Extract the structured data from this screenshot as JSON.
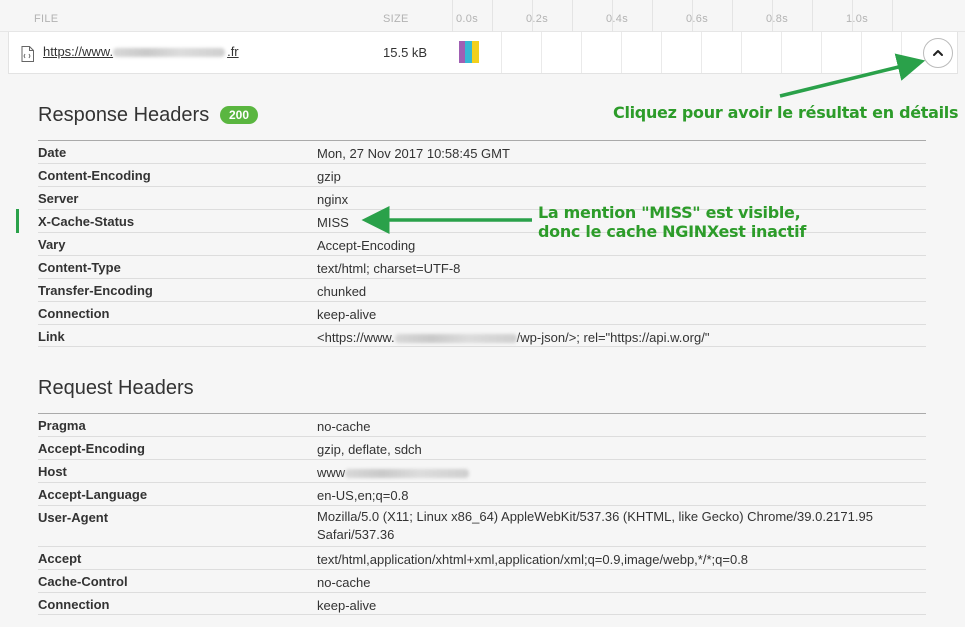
{
  "columns": {
    "file": "FILE",
    "size": "SIZE"
  },
  "timeline_ticks": [
    "0.0s",
    "0.2s",
    "0.4s",
    "0.6s",
    "0.8s",
    "1.0s"
  ],
  "file": {
    "url_prefix": "https://www.",
    "url_suffix": ".fr",
    "size": "15.5 kB",
    "bar_colors": [
      "#a05fb3",
      "#36b8d4",
      "#f2d01c"
    ]
  },
  "response": {
    "title": "Response Headers",
    "status": "200",
    "headers": [
      {
        "key": "Date",
        "value": "Mon, 27 Nov 2017 10:58:45 GMT"
      },
      {
        "key": "Content-Encoding",
        "value": "gzip"
      },
      {
        "key": "Server",
        "value": "nginx"
      },
      {
        "key": "X-Cache-Status",
        "value": "MISS"
      },
      {
        "key": "Vary",
        "value": "Accept-Encoding"
      },
      {
        "key": "Content-Type",
        "value": "text/html; charset=UTF-8"
      },
      {
        "key": "Transfer-Encoding",
        "value": "chunked"
      },
      {
        "key": "Connection",
        "value": "keep-alive"
      },
      {
        "key": "Link",
        "value_prefix": "<https://www.",
        "value_suffix": "/wp-json/>; rel=\"https://api.w.org/\""
      }
    ]
  },
  "request": {
    "title": "Request Headers",
    "headers": [
      {
        "key": "Pragma",
        "value": "no-cache"
      },
      {
        "key": "Accept-Encoding",
        "value": "gzip, deflate, sdch"
      },
      {
        "key": "Host",
        "value": "www"
      },
      {
        "key": "Accept-Language",
        "value": "en-US,en;q=0.8"
      },
      {
        "key": "User-Agent",
        "value": "Mozilla/5.0 (X11; Linux x86_64) AppleWebKit/537.36 (KHTML, like Gecko) Chrome/39.0.2171.95 Safari/537.36"
      },
      {
        "key": "Accept",
        "value": "text/html,application/xhtml+xml,application/xml;q=0.9,image/webp,*/*;q=0.8"
      },
      {
        "key": "Cache-Control",
        "value": "no-cache"
      },
      {
        "key": "Connection",
        "value": "keep-alive"
      }
    ]
  },
  "annotations": {
    "details": "Cliquez pour avoir le résultat en détails",
    "miss_line1": "La mention \"MISS\" est visible,",
    "miss_line2": "donc le cache NGINXest inactif",
    "color": "#2d9c2a"
  }
}
